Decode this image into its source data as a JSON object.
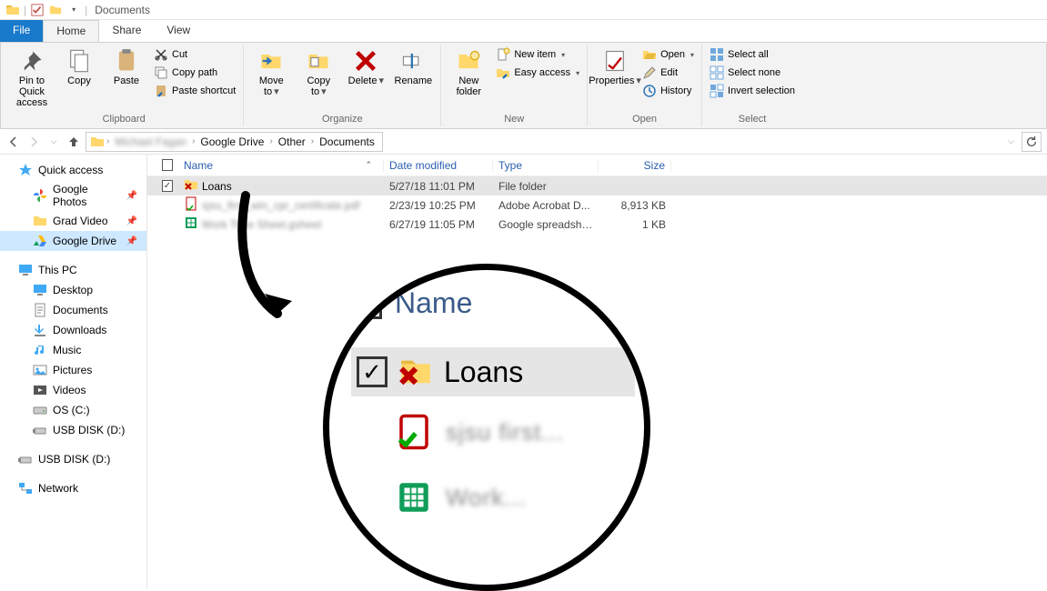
{
  "window": {
    "title": "Documents"
  },
  "tabs": {
    "file": "File",
    "home": "Home",
    "share": "Share",
    "view": "View"
  },
  "ribbon": {
    "clipboard": {
      "label": "Clipboard",
      "pin": "Pin to Quick access",
      "copy": "Copy",
      "paste": "Paste",
      "cut": "Cut",
      "copypath": "Copy path",
      "pastesc": "Paste shortcut"
    },
    "organize": {
      "label": "Organize",
      "moveto": "Move to",
      "copyto": "Copy to",
      "delete": "Delete",
      "rename": "Rename"
    },
    "new": {
      "label": "New",
      "newfolder": "New folder",
      "newitem": "New item",
      "easyaccess": "Easy access"
    },
    "open": {
      "label": "Open",
      "properties": "Properties",
      "open": "Open",
      "edit": "Edit",
      "history": "History"
    },
    "select": {
      "label": "Select",
      "all": "Select all",
      "none": "Select none",
      "invert": "Invert selection"
    }
  },
  "breadcrumb": {
    "user": "Michael Fagan",
    "gd": "Google Drive",
    "other": "Other",
    "docs": "Documents"
  },
  "columns": {
    "name": "Name",
    "date": "Date modified",
    "type": "Type",
    "size": "Size"
  },
  "rows": [
    {
      "name": "Loans",
      "date": "5/27/18 11:01 PM",
      "type": "File folder",
      "size": "",
      "selected": true,
      "icon": "folder-sync-err",
      "blurred": false
    },
    {
      "name": "sjsu_first_win_cpr_certificate.pdf",
      "date": "2/23/19 10:25 PM",
      "type": "Adobe Acrobat D...",
      "size": "8,913 KB",
      "selected": false,
      "icon": "pdf",
      "blurred": true
    },
    {
      "name": "Work Time Sheet.gsheet",
      "date": "6/27/19 11:05 PM",
      "type": "Google spreadsheet",
      "size": "1 KB",
      "selected": false,
      "icon": "gsheet",
      "blurred": true
    }
  ],
  "sidebar": {
    "quick": "Quick access",
    "items1": [
      {
        "label": "Google Photos",
        "icon": "gphotos",
        "pinned": true
      },
      {
        "label": "Grad Video",
        "icon": "folder",
        "pinned": true
      },
      {
        "label": "Google Drive",
        "icon": "gdrive",
        "pinned": true,
        "selected": true
      }
    ],
    "thispc": "This PC",
    "items2": [
      {
        "label": "Desktop",
        "icon": "desktop"
      },
      {
        "label": "Documents",
        "icon": "documents"
      },
      {
        "label": "Downloads",
        "icon": "downloads"
      },
      {
        "label": "Music",
        "icon": "music"
      },
      {
        "label": "Pictures",
        "icon": "pictures"
      },
      {
        "label": "Videos",
        "icon": "videos"
      },
      {
        "label": "OS (C:)",
        "icon": "drive"
      },
      {
        "label": "USB DISK (D:)",
        "icon": "usb"
      }
    ],
    "usb": "USB DISK (D:)",
    "network": "Network"
  },
  "zoom": {
    "name": "Name",
    "loans": "Loans"
  }
}
